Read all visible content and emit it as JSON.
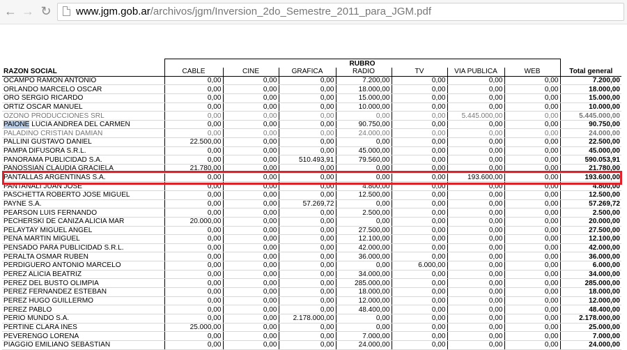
{
  "browser": {
    "url_host": "www.jgm.gob.ar",
    "url_path": "/archivos/jgm/Inversion_2do_Semestre_2011_para_JGM.pdf"
  },
  "table": {
    "group_header": "RUBRO",
    "columns": [
      "RAZON SOCIAL",
      "CABLE",
      "CINE",
      "GRAFICA",
      "RADIO",
      "TV",
      "VIA PUBLICA",
      "WEB",
      "Total general"
    ],
    "rows": [
      [
        "OCAMPO RAMON ANTONIO",
        "0,00",
        "0,00",
        "0,00",
        "7.200,00",
        "0,00",
        "0,00",
        "0,00",
        "7.200,00"
      ],
      [
        "ORLANDO MARCELO OSCAR",
        "0,00",
        "0,00",
        "0,00",
        "18.000,00",
        "0,00",
        "0,00",
        "0,00",
        "18.000,00"
      ],
      [
        "ORO SERGIO RICARDO",
        "0,00",
        "0,00",
        "0,00",
        "15.000,00",
        "0,00",
        "0,00",
        "0,00",
        "15.000,00"
      ],
      [
        "ORTIZ OSCAR MANUEL",
        "0,00",
        "0,00",
        "0,00",
        "10.000,00",
        "0,00",
        "0,00",
        "0,00",
        "10.000,00"
      ],
      [
        "OZONO PRODUCCIONES SRL",
        "0,00",
        "0,00",
        "0,00",
        "0,00",
        "0,00",
        "5.445.000,00",
        "0,00",
        "5.445.000,00"
      ],
      [
        "PAIONE LUCIA ANDREA DEL CARMEN",
        "0,00",
        "0,00",
        "0,00",
        "90.750,00",
        "0,00",
        "0,00",
        "0,00",
        "90.750,00"
      ],
      [
        "PALADINO CRISTIAN DAMIAN",
        "0,00",
        "0,00",
        "0,00",
        "24.000,00",
        "0,00",
        "0,00",
        "0,00",
        "24.000,00"
      ],
      [
        "PALLINI GUSTAVO DANIEL",
        "22.500,00",
        "0,00",
        "0,00",
        "0,00",
        "0,00",
        "0,00",
        "0,00",
        "22.500,00"
      ],
      [
        "PAMPA DIFUSORA S.R.L.",
        "0,00",
        "0,00",
        "0,00",
        "45.000,00",
        "0,00",
        "0,00",
        "0,00",
        "45.000,00"
      ],
      [
        "PANORAMA PUBLICIDAD S.A.",
        "0,00",
        "0,00",
        "510.493,91",
        "79.560,00",
        "0,00",
        "0,00",
        "0,00",
        "590.053,91"
      ],
      [
        "PANOSSIAN CLAUDIA GRACIELA",
        "21.780,00",
        "0,00",
        "0,00",
        "0,00",
        "0,00",
        "0,00",
        "0,00",
        "21.780,00"
      ],
      [
        "PANTALLAS ARGENTINAS S.A.",
        "0,00",
        "0,00",
        "0,00",
        "0,00",
        "0,00",
        "193.600,00",
        "0,00",
        "193.600,00"
      ],
      [
        "PANTANALI JUAN JOSE",
        "0,00",
        "0,00",
        "0,00",
        "4.800,00",
        "0,00",
        "0,00",
        "0,00",
        "4.800,00"
      ],
      [
        "PASCHETTA ROBERTO JOSE MIGUEL",
        "0,00",
        "0,00",
        "0,00",
        "12.500,00",
        "0,00",
        "0,00",
        "0,00",
        "12.500,00"
      ],
      [
        "PAYNE S.A.",
        "0,00",
        "0,00",
        "57.269,72",
        "0,00",
        "0,00",
        "0,00",
        "0,00",
        "57.269,72"
      ],
      [
        "PEARSON LUIS FERNANDO",
        "0,00",
        "0,00",
        "0,00",
        "2.500,00",
        "0,00",
        "0,00",
        "0,00",
        "2.500,00"
      ],
      [
        "PECHERSKI DE CANIZA ALICIA MAR",
        "20.000,00",
        "0,00",
        "0,00",
        "0,00",
        "0,00",
        "0,00",
        "0,00",
        "20.000,00"
      ],
      [
        "PELAYTAY MIGUEL ANGEL",
        "0,00",
        "0,00",
        "0,00",
        "27.500,00",
        "0,00",
        "0,00",
        "0,00",
        "27.500,00"
      ],
      [
        "PENA MARTIN MIGUEL",
        "0,00",
        "0,00",
        "0,00",
        "12.100,00",
        "0,00",
        "0,00",
        "0,00",
        "12.100,00"
      ],
      [
        "PENSADO PARA PUBLICIDAD S.R.L.",
        "0,00",
        "0,00",
        "0,00",
        "42.000,00",
        "0,00",
        "0,00",
        "0,00",
        "42.000,00"
      ],
      [
        "PERALTA OSMAR RUBEN",
        "0,00",
        "0,00",
        "0,00",
        "36.000,00",
        "0,00",
        "0,00",
        "0,00",
        "36.000,00"
      ],
      [
        "PERDIGUERO ANTONIO MARCELO",
        "0,00",
        "0,00",
        "0,00",
        "0,00",
        "6.000,00",
        "0,00",
        "0,00",
        "6.000,00"
      ],
      [
        "PEREZ ALICIA BEATRIZ",
        "0,00",
        "0,00",
        "0,00",
        "34.000,00",
        "0,00",
        "0,00",
        "0,00",
        "34.000,00"
      ],
      [
        "PEREZ DEL BUSTO OLIMPIA",
        "0,00",
        "0,00",
        "0,00",
        "285.000,00",
        "0,00",
        "0,00",
        "0,00",
        "285.000,00"
      ],
      [
        "PEREZ FERNANDEZ ESTEBAN",
        "0,00",
        "0,00",
        "0,00",
        "18.000,00",
        "0,00",
        "0,00",
        "0,00",
        "18.000,00"
      ],
      [
        "PEREZ HUGO GUILLERMO",
        "0,00",
        "0,00",
        "0,00",
        "12.000,00",
        "0,00",
        "0,00",
        "0,00",
        "12.000,00"
      ],
      [
        "PEREZ PABLO",
        "0,00",
        "0,00",
        "0,00",
        "48.400,00",
        "0,00",
        "0,00",
        "0,00",
        "48.400,00"
      ],
      [
        "PERIO MUNDO S.A.",
        "0,00",
        "0,00",
        "2.178.000,00",
        "0,00",
        "0,00",
        "0,00",
        "0,00",
        "2.178.000,00"
      ],
      [
        "PERTINE CLARA INES",
        "25.000,00",
        "0,00",
        "0,00",
        "0,00",
        "0,00",
        "0,00",
        "0,00",
        "25.000,00"
      ],
      [
        "PEVERENGO LORENA",
        "0,00",
        "0,00",
        "0,00",
        "7.000,00",
        "0,00",
        "0,00",
        "0,00",
        "7.000,00"
      ],
      [
        "PIAGGIO EMILIANO SEBASTIAN",
        "0,00",
        "0,00",
        "0,00",
        "24.000,00",
        "0,00",
        "0,00",
        "0,00",
        "24.000,00"
      ]
    ],
    "highlighted_row_index": 5,
    "selected_text": "PAIONE"
  },
  "colors": {
    "highlight_border": "#e0212a",
    "selection": "#b8cde8"
  },
  "icons": {
    "back": "back-arrow-icon",
    "forward": "forward-arrow-icon",
    "reload": "reload-icon",
    "page": "page-icon"
  }
}
